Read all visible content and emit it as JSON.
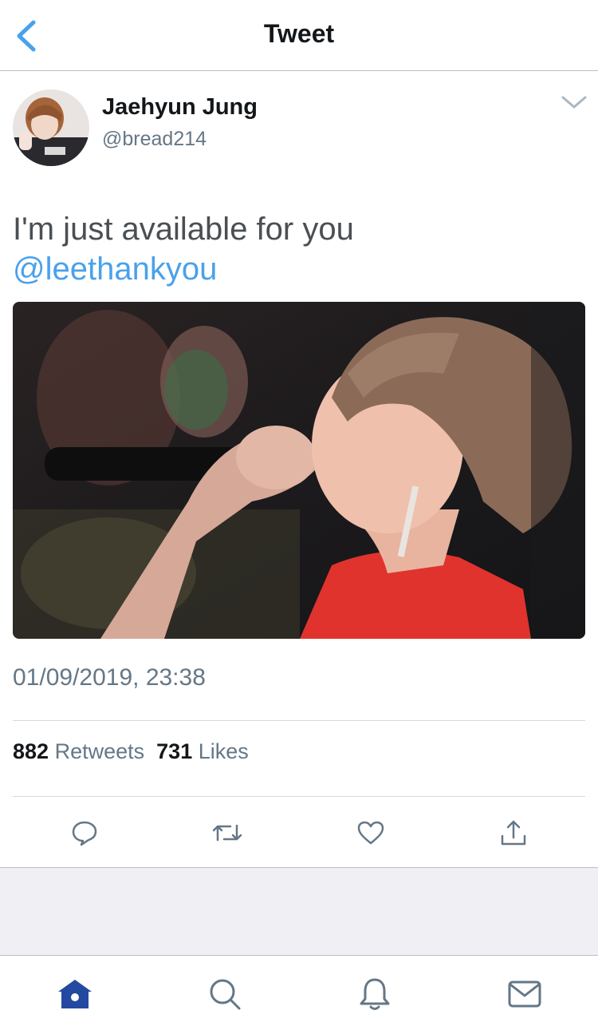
{
  "header": {
    "title": "Tweet",
    "back_icon": "chevron-left-icon"
  },
  "author": {
    "name": "Jaehyun Jung",
    "handle": "@bread214"
  },
  "tweet": {
    "text": "I'm just available for you",
    "mention": "@leethankyou"
  },
  "timestamp": "01/09/2019, 23:38",
  "stats": {
    "retweets_count": "882",
    "retweets_label": "Retweets",
    "likes_count": "731",
    "likes_label": "Likes"
  },
  "actions": [
    "reply-icon",
    "retweet-icon",
    "like-icon",
    "share-icon"
  ],
  "tabs": [
    "home-icon",
    "search-icon",
    "notifications-icon",
    "messages-icon"
  ],
  "colors": {
    "accent": "#4aa1eb",
    "secondary_text": "#657786",
    "tab_active": "#2349a0"
  }
}
